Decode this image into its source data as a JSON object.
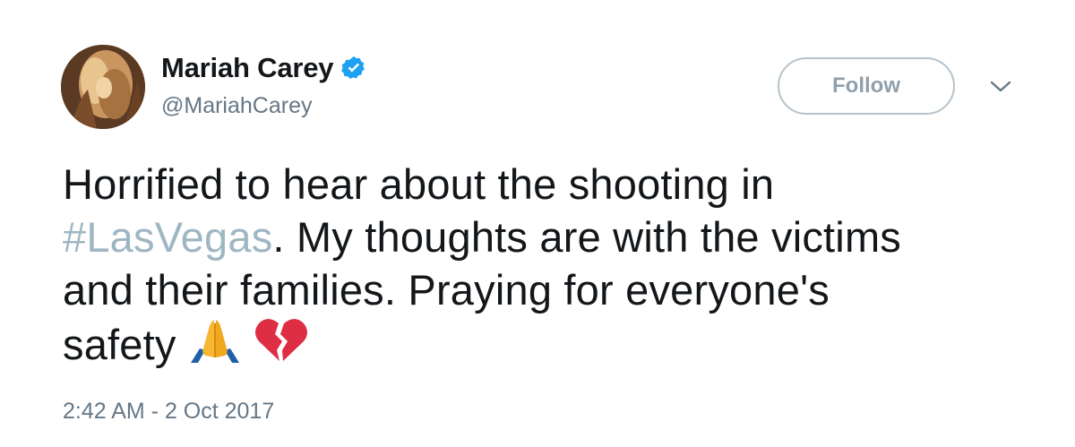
{
  "author": {
    "name": "Mariah Carey",
    "handle": "@MariahCarey",
    "verified_icon": "verified-badge-icon"
  },
  "actions": {
    "follow_label": "Follow",
    "menu_icon": "chevron-down-icon"
  },
  "tweet": {
    "line1": "Horrified to hear about the shooting in",
    "hashtag": "#LasVegas",
    "line2_rest": ". My thoughts are with the victims",
    "line3": "and their families. Praying for everyone's",
    "line4": "safety",
    "emojis": [
      "folded-hands-icon",
      "broken-heart-icon"
    ]
  },
  "timestamp": "2:42 AM - 2 Oct 2017",
  "colors": {
    "text": "#14171a",
    "muted": "#657786",
    "hashtag": "#9fb6c3",
    "verified": "#1da1f2",
    "button_border": "#b6c3cc"
  }
}
